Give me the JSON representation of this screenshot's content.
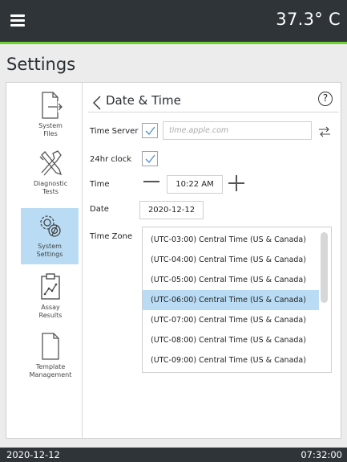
{
  "header": {
    "temperature": "37.3° C",
    "menu_icon": "hamburger-menu-icon",
    "accent_color": "#6fd22e",
    "bar_color": "#2e3438"
  },
  "page": {
    "title": "Settings"
  },
  "sidebar": {
    "items": [
      {
        "label_line1": "System",
        "label_line2": "Files",
        "icon": "file-export-icon",
        "active": false
      },
      {
        "label_line1": "Diagnostic",
        "label_line2": "Tests",
        "icon": "tools-icon",
        "active": false
      },
      {
        "label_line1": "System",
        "label_line2": "Settings",
        "icon": "gears-icon",
        "active": true
      },
      {
        "label_line1": "Assay",
        "label_line2": "Results",
        "icon": "clipboard-chart-icon",
        "active": false
      },
      {
        "label_line1": "Template",
        "label_line2": "Management",
        "icon": "document-icon",
        "active": false
      }
    ],
    "active_color": "#b9dcf4"
  },
  "content": {
    "title": "Date & Time",
    "help_symbol": "?",
    "time_server": {
      "label": "Time Server",
      "checked": true,
      "value": "",
      "placeholder": "time.apple.com"
    },
    "clock_24hr": {
      "label": "24hr clock",
      "checked": true
    },
    "time": {
      "label": "Time",
      "value": "10:22 AM"
    },
    "date": {
      "label": "Date",
      "value": "2020-12-12"
    },
    "time_zone": {
      "label": "Time Zone",
      "options": [
        "(UTC-03:00) Central Time (US & Canada)",
        "(UTC-04:00) Central Time (US & Canada)",
        "(UTC-05:00) Central Time (US & Canada)",
        "(UTC-06:00) Central Time (US & Canada)",
        "(UTC-07:00) Central Time (US & Canada)",
        "(UTC-08:00) Central Time (US & Canada)",
        "(UTC-09:00) Central Time (US & Canada)"
      ],
      "selected_index": 3
    }
  },
  "status_bar": {
    "date": "2020-12-12",
    "time": "07:32:00"
  }
}
